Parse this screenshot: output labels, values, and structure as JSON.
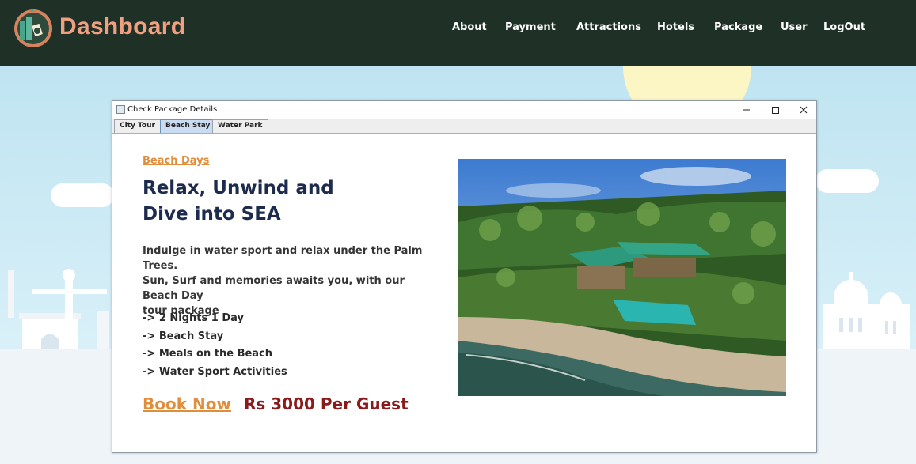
{
  "header": {
    "brand": "Dashboard",
    "nav": [
      "About",
      "Payment",
      "Attractions",
      "Hotels",
      "Package",
      "User",
      "LogOut"
    ]
  },
  "window": {
    "title": "Check Package Details",
    "tabs": [
      {
        "label": "City Tour",
        "active": false
      },
      {
        "label": "Beach Stay",
        "active": true
      },
      {
        "label": "Water Park",
        "active": false
      }
    ]
  },
  "package": {
    "subtitle": "Beach Days",
    "headline_line1": "Relax, Unwind and",
    "headline_line2": "Dive into SEA",
    "description_line1": "Indulge in water sport and relax under the Palm Trees.",
    "description_line2": "Sun, Surf and memories awaits you, with our Beach Day",
    "description_line3": "tour package",
    "features": [
      "-> 2 Nights 1 Day",
      "-> Beach Stay",
      "-> Meals on the Beach",
      "-> Water Sport Activities"
    ],
    "book_label": "Book Now",
    "price": "Rs 3000 Per Guest"
  },
  "colors": {
    "topbar": "#1f3127",
    "brand": "#f0a080",
    "accent": "#e08d3c",
    "headline": "#1c2b4e",
    "price": "#8b1a1a",
    "active_tab": "#c9dcf2"
  },
  "icons": {
    "logo": "travel-logo-icon",
    "window_app": "java-app-icon",
    "minimize": "minimize-icon",
    "maximize": "maximize-icon",
    "close": "close-icon"
  }
}
